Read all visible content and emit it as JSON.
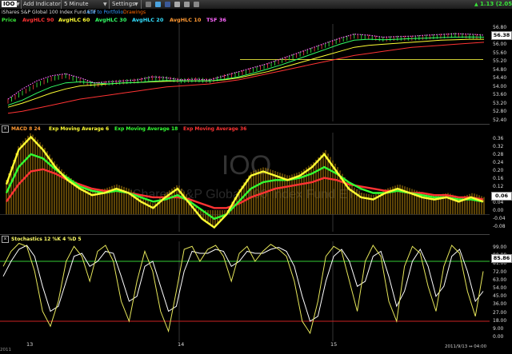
{
  "toolbar": {
    "symbol": "IOO",
    "add_indicator": "Add Indicator",
    "interval": "5 Minute",
    "settings": "Settings",
    "change": "1.13 (2.05%)",
    "change_color": "#39e639"
  },
  "subheader": {
    "fund_name": "iShares S&P Global 100 Index Fund ETF",
    "add_portfolio": "Add to Portfolio",
    "drawings": "Drawings"
  },
  "indicators": [
    {
      "label": "Price",
      "color": "#39e639"
    },
    {
      "label": "AvgHLC 90",
      "color": "#ff3333"
    },
    {
      "label": "AvgHLC 60",
      "color": "#ffff33"
    },
    {
      "label": "AvgHLC 30",
      "color": "#33ff66"
    },
    {
      "label": "AvgHLC 20",
      "color": "#33e0ff"
    },
    {
      "label": "AvgHLC 10",
      "color": "#ff9933"
    },
    {
      "label": "TSF 36",
      "color": "#ff66ff"
    }
  ],
  "price_panel": {
    "last_price": "56.38",
    "axis_labels": [
      "56.80",
      "56.38",
      "56.00",
      "55.60",
      "55.20",
      "54.80",
      "54.40",
      "54.00",
      "53.60",
      "53.20",
      "52.80",
      "52.40"
    ]
  },
  "macd_panel": {
    "title": "MACD 8 24",
    "legend": [
      {
        "label": "Exp Moving Average 6",
        "color": "#ffff33"
      },
      {
        "label": "Exp Moving Average 18",
        "color": "#33ff33"
      },
      {
        "label": "Exp Moving Average 36",
        "color": "#ff3333"
      }
    ],
    "last_value": "0.06",
    "axis_labels": [
      "0.36",
      "0.32",
      "0.28",
      "0.24",
      "0.20",
      "0.16",
      "0.12",
      "0.08",
      "0.04",
      "0.00",
      "-0.04",
      "-0.08"
    ],
    "watermark_symbol": "IOO",
    "watermark_name": "iShares S&P Global 100 Index Fund ETF"
  },
  "stoch_panel": {
    "title": "Stochastics 12 %K 4 %D 5",
    "last_value": "85.86",
    "axis_labels": [
      "99.00",
      "90.00",
      "81.00",
      "72.00",
      "63.00",
      "54.00",
      "45.00",
      "36.00",
      "27.00",
      "18.00",
      "9.00",
      "0.00"
    ],
    "upper_line": 80,
    "lower_line": 20
  },
  "xaxis": {
    "labels": [
      "13",
      "14",
      "15"
    ],
    "left_label": "2011",
    "timestamp": "2011/9/13 ↔ 04:00"
  },
  "chart_data": [
    {
      "type": "line",
      "title": "IOO 5 Minute",
      "ylim": [
        52.2,
        57.0
      ],
      "series": [
        {
          "name": "Price",
          "values": [
            53.2,
            53.6,
            54.0,
            54.3,
            54.45,
            54.2,
            54.0,
            54.1,
            54.15,
            54.2,
            54.35,
            54.3,
            54.2,
            54.25,
            54.2,
            54.4,
            54.55,
            54.75,
            54.95,
            55.2,
            55.45,
            55.7,
            55.95,
            56.2,
            56.4,
            56.35,
            56.25,
            56.3,
            56.3,
            56.35,
            56.4,
            56.45,
            56.4,
            56.38
          ]
        },
        {
          "name": "AvgHLC 90",
          "values": [
            52.6,
            52.7,
            52.85,
            53.0,
            53.15,
            53.3,
            53.4,
            53.5,
            53.6,
            53.7,
            53.8,
            53.9,
            53.95,
            54.0,
            54.05,
            54.15,
            54.25,
            54.4,
            54.55,
            54.7,
            54.85,
            55.0,
            55.15,
            55.3,
            55.45,
            55.55,
            55.65,
            55.75,
            55.85,
            55.9,
            55.95,
            56.0,
            56.05,
            56.1
          ]
        },
        {
          "name": "AvgHLC 60",
          "values": [
            52.9,
            53.1,
            53.35,
            53.6,
            53.8,
            53.95,
            54.0,
            54.05,
            54.1,
            54.12,
            54.15,
            54.18,
            54.2,
            54.2,
            54.2,
            54.25,
            54.35,
            54.5,
            54.65,
            54.85,
            55.05,
            55.25,
            55.45,
            55.65,
            55.85,
            55.95,
            56.0,
            56.05,
            56.1,
            56.15,
            56.2,
            56.22,
            56.25,
            56.25
          ]
        },
        {
          "name": "AvgHLC 30",
          "values": [
            53.0,
            53.25,
            53.6,
            53.9,
            54.1,
            54.15,
            54.1,
            54.05,
            54.1,
            54.12,
            54.18,
            54.22,
            54.2,
            54.2,
            54.2,
            54.28,
            54.4,
            54.58,
            54.78,
            55.0,
            55.25,
            55.5,
            55.75,
            56.0,
            56.2,
            56.25,
            56.22,
            56.25,
            56.28,
            56.3,
            56.33,
            56.35,
            56.36,
            56.35
          ]
        },
        {
          "name": "TSF 36",
          "values": [
            53.3,
            53.8,
            54.2,
            54.45,
            54.55,
            54.35,
            54.1,
            54.15,
            54.2,
            54.25,
            54.4,
            54.35,
            54.25,
            54.28,
            54.25,
            54.45,
            54.65,
            54.85,
            55.05,
            55.3,
            55.55,
            55.8,
            56.05,
            56.3,
            56.5,
            56.45,
            56.35,
            56.38,
            56.4,
            56.45,
            56.48,
            56.52,
            56.5,
            56.45
          ]
        }
      ],
      "support_level": 55.25
    },
    {
      "type": "line",
      "title": "MACD 8 24",
      "ylim": [
        -0.08,
        0.38
      ],
      "bar_range": [
        0.0,
        0.3
      ],
      "series": [
        {
          "name": "Exp Moving Average 6",
          "values": [
            0.14,
            0.3,
            0.36,
            0.3,
            0.22,
            0.16,
            0.12,
            0.09,
            0.1,
            0.12,
            0.1,
            0.06,
            0.03,
            0.08,
            0.12,
            0.05,
            -0.02,
            -0.06,
            0.0,
            0.1,
            0.18,
            0.2,
            0.18,
            0.16,
            0.18,
            0.22,
            0.28,
            0.2,
            0.12,
            0.08,
            0.07,
            0.1,
            0.12,
            0.1,
            0.08,
            0.07,
            0.08,
            0.06,
            0.08,
            0.06
          ]
        },
        {
          "name": "Exp Moving Average 18",
          "values": [
            0.1,
            0.22,
            0.28,
            0.26,
            0.21,
            0.17,
            0.13,
            0.11,
            0.1,
            0.11,
            0.1,
            0.08,
            0.06,
            0.07,
            0.09,
            0.06,
            0.02,
            -0.02,
            0.0,
            0.06,
            0.12,
            0.15,
            0.16,
            0.16,
            0.17,
            0.19,
            0.22,
            0.19,
            0.15,
            0.12,
            0.1,
            0.1,
            0.11,
            0.1,
            0.09,
            0.08,
            0.08,
            0.07,
            0.07,
            0.06
          ]
        },
        {
          "name": "Exp Moving Average 36",
          "values": [
            0.06,
            0.14,
            0.2,
            0.21,
            0.19,
            0.16,
            0.14,
            0.12,
            0.11,
            0.11,
            0.1,
            0.09,
            0.08,
            0.08,
            0.08,
            0.07,
            0.05,
            0.03,
            0.03,
            0.05,
            0.08,
            0.1,
            0.12,
            0.13,
            0.14,
            0.15,
            0.17,
            0.16,
            0.14,
            0.13,
            0.12,
            0.11,
            0.11,
            0.1,
            0.1,
            0.09,
            0.09,
            0.08,
            0.08,
            0.07
          ]
        }
      ]
    },
    {
      "type": "line",
      "title": "Stochastics 12 %K 4 %D 5",
      "ylim": [
        0,
        100
      ],
      "series": [
        {
          "name": "%K",
          "values": [
            75,
            90,
            98,
            95,
            70,
            30,
            15,
            40,
            80,
            95,
            85,
            60,
            90,
            96,
            80,
            40,
            20,
            60,
            90,
            70,
            30,
            10,
            50,
            92,
            95,
            80,
            92,
            96,
            85,
            60,
            88,
            95,
            80,
            90,
            97,
            92,
            85,
            60,
            20,
            8,
            40,
            85,
            95,
            90,
            60,
            30,
            80,
            96,
            85,
            40,
            20,
            75,
            95,
            88,
            55,
            30,
            75,
            96,
            88,
            50,
            25,
            70
          ]
        },
        {
          "name": "%D",
          "values": [
            65,
            80,
            92,
            96,
            85,
            55,
            30,
            35,
            60,
            85,
            88,
            75,
            80,
            90,
            88,
            65,
            40,
            45,
            75,
            80,
            55,
            30,
            35,
            70,
            90,
            88,
            88,
            92,
            90,
            75,
            80,
            90,
            88,
            88,
            92,
            94,
            90,
            75,
            45,
            20,
            25,
            60,
            85,
            92,
            80,
            55,
            60,
            85,
            90,
            65,
            35,
            50,
            80,
            92,
            75,
            45,
            55,
            85,
            92,
            70,
            40,
            50
          ]
        }
      ]
    }
  ]
}
